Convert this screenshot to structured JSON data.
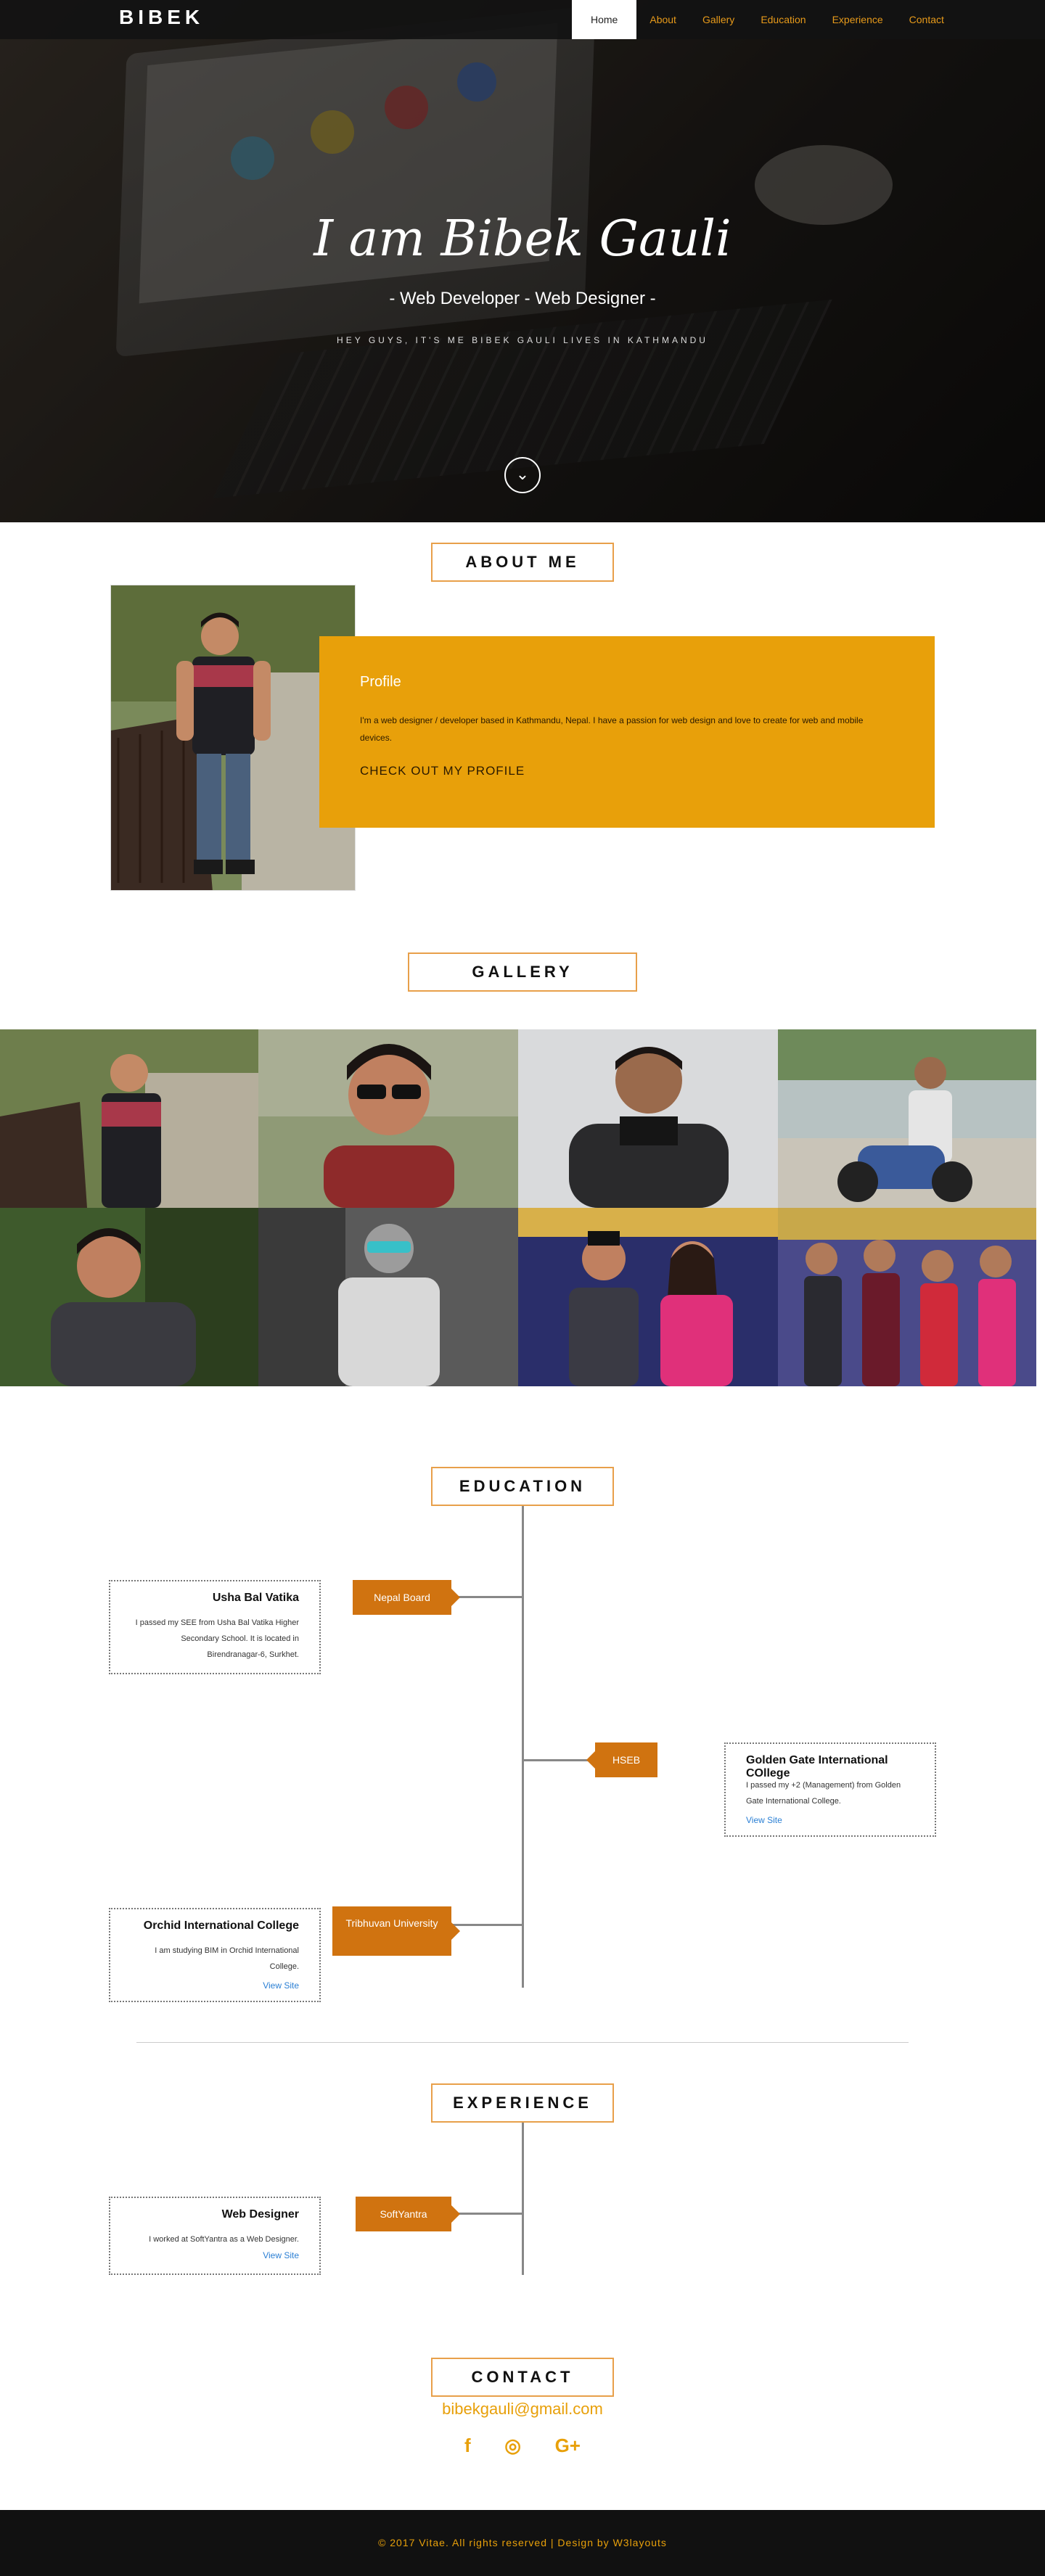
{
  "nav": {
    "brand": "BIBEK",
    "items": [
      {
        "label": "Home"
      },
      {
        "label": "About"
      },
      {
        "label": "Gallery"
      },
      {
        "label": "Education"
      },
      {
        "label": "Experience"
      },
      {
        "label": "Contact"
      }
    ]
  },
  "hero": {
    "title": "I am Bibek Gauli",
    "subtitle": "- Web Developer - Web Designer -",
    "tagline": "HEY GUYS, IT'S ME BIBEK GAULI LIVES IN KATHMANDU",
    "scroll_icon": "chevron-down-icon"
  },
  "about": {
    "title": "ABOUT ME",
    "profile_heading": "Profile",
    "profile_text": "I'm a web designer / developer based in Kathmandu, Nepal. I have a passion for web design and love to create for web and mobile devices.",
    "profile_link": "CHECK OUT MY PROFILE"
  },
  "gallery": {
    "title": "GALLERY"
  },
  "education": {
    "title": "EDUCATION",
    "entries": [
      {
        "tag": "Nepal Board",
        "school": "Usha Bal Vatika",
        "text": "I passed my SEE from Usha Bal Vatika Higher Secondary School. It is located in Birendranagar-6, Surkhet.",
        "link": ""
      },
      {
        "tag": "HSEB",
        "school": "Golden Gate International COllege",
        "text": "I passed my +2 (Management) from Golden Gate International College.",
        "link": "View Site"
      },
      {
        "tag": "Tribhuvan University",
        "school": "Orchid International College",
        "text": "I am studying BIM in Orchid International College.",
        "link": "View Site"
      }
    ]
  },
  "experience": {
    "title": "EXPERIENCE",
    "entries": [
      {
        "tag": "SoftYantra",
        "role": "Web Designer",
        "text": "I worked at SoftYantra as a Web Designer.",
        "link": "View Site"
      }
    ]
  },
  "contact": {
    "title": "CONTACT",
    "email": "bibekgauli@gmail.com",
    "socials": [
      {
        "icon": "facebook-icon",
        "glyph": "f"
      },
      {
        "icon": "instagram-icon",
        "glyph": "◎"
      },
      {
        "icon": "google-plus-icon",
        "glyph": "G+"
      }
    ]
  },
  "footer": {
    "text": "© 2017 Vitae. All rights reserved | Design by W3layouts"
  },
  "colors": {
    "accent": "#e8a00a",
    "tag": "#d07310",
    "footer_bg": "#111111"
  }
}
